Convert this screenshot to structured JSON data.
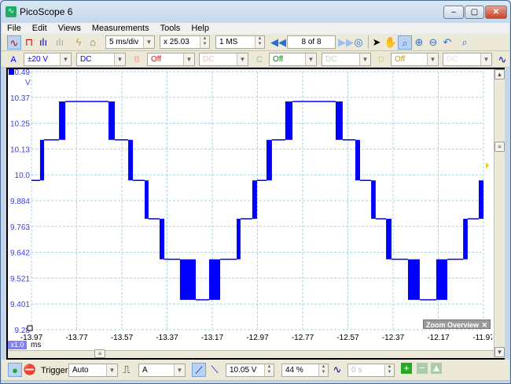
{
  "window": {
    "title": "PicoScope 6",
    "minimize": "–",
    "maximize": "▢",
    "close": "✕"
  },
  "menu": [
    "File",
    "Edit",
    "Views",
    "Measurements",
    "Tools",
    "Help"
  ],
  "toolbar1": {
    "timebase": "5 ms/div",
    "zoom": "x 25.03",
    "samples": "1 MS",
    "buffer": "8  of 8"
  },
  "channels": [
    {
      "letter": "A",
      "range": "±20 V",
      "coupling": "DC",
      "color": "#0000ff",
      "enabled": true
    },
    {
      "letter": "B",
      "range": "Off",
      "coupling": "DC",
      "color": "#ff0000",
      "enabled": false
    },
    {
      "letter": "C",
      "range": "Off",
      "coupling": "DC",
      "color": "#008000",
      "enabled": false
    },
    {
      "letter": "D",
      "range": "Off",
      "coupling": "DC",
      "color": "#c89600",
      "enabled": false
    }
  ],
  "trigger": {
    "label": "Trigger",
    "mode": "Auto",
    "source": "A",
    "level": "10.05 V",
    "pretrigger": "44 %",
    "delay": "0 s"
  },
  "zoom_overview": {
    "label": "Zoom Overview"
  },
  "x_zoom_badge": "x1.0",
  "chart_data": {
    "type": "line",
    "xlabel": "ms",
    "ylabel": "V",
    "xlim": [
      -13.97,
      -11.97
    ],
    "ylim": [
      9.28,
      10.49
    ],
    "xticks": [
      "-13.97",
      "-13.77",
      "-13.57",
      "-13.37",
      "-13.17",
      "-12.97",
      "-12.77",
      "-12.57",
      "-12.37",
      "-12.17",
      "-11.97"
    ],
    "yticks": [
      "10.49",
      "10.37",
      "10.25",
      "10.13",
      "10.0",
      "9.884",
      "9.763",
      "9.642",
      "9.521",
      "9.401",
      "9.28"
    ],
    "grid": true,
    "series": [
      {
        "color": "#0000ff",
        "start_level": 9.98,
        "steps": [
          [
            -13.932,
            -13.914,
            10.17
          ],
          [
            -13.848,
            -13.82,
            10.35
          ],
          [
            -13.629,
            -13.601,
            10.17
          ],
          [
            -13.542,
            -13.521,
            9.98
          ],
          [
            -13.469,
            -13.452,
            9.8
          ],
          [
            -13.403,
            -13.382,
            9.61
          ],
          [
            -13.313,
            -13.243,
            9.42
          ],
          [
            -13.184,
            -13.135,
            9.61
          ],
          [
            -13.062,
            -13.045,
            9.8
          ],
          [
            -12.993,
            -12.972,
            9.98
          ],
          [
            -12.93,
            -12.906,
            10.17
          ],
          [
            -12.847,
            -12.815,
            10.35
          ],
          [
            -12.624,
            -12.593,
            10.17
          ],
          [
            -12.537,
            -12.516,
            9.98
          ],
          [
            -12.467,
            -12.447,
            9.8
          ],
          [
            -12.401,
            -12.377,
            9.61
          ],
          [
            -12.304,
            -12.252,
            9.42
          ],
          [
            -12.179,
            -12.13,
            9.61
          ],
          [
            -12.06,
            -12.04,
            9.8
          ],
          [
            -11.991,
            -11.97,
            9.98
          ]
        ]
      }
    ]
  }
}
